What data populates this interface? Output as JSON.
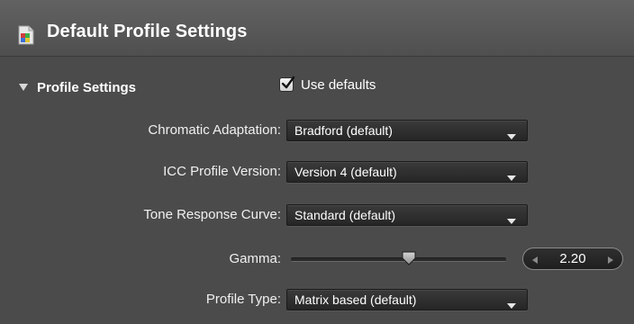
{
  "header": {
    "title": "Default Profile Settings",
    "icon": "profile-document-icon"
  },
  "section": {
    "title": "Profile Settings",
    "expanded": true,
    "use_defaults": {
      "label": "Use defaults",
      "checked": true
    }
  },
  "settings": {
    "chromatic_adaptation": {
      "label": "Chromatic Adaptation:",
      "value": "Bradford (default)"
    },
    "icc_profile_version": {
      "label": "ICC Profile Version:",
      "value": "Version 4 (default)"
    },
    "tone_response_curve": {
      "label": "Tone Response Curve:",
      "value": "Standard (default)"
    },
    "gamma": {
      "label": "Gamma:",
      "value": "2.20",
      "slider_fraction": 0.55
    },
    "profile_type": {
      "label": "Profile Type:",
      "value": "Matrix based (default)"
    }
  },
  "colors": {
    "panel_background": "#4b4b4b",
    "control_background": "#262626",
    "text": "#ffffff"
  }
}
